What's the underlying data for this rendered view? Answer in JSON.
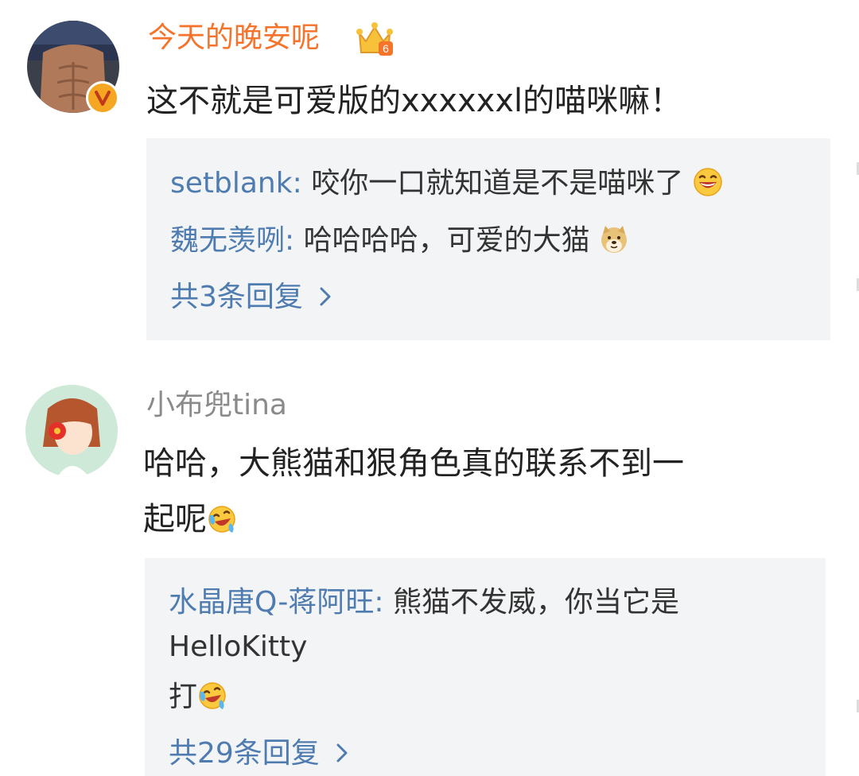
{
  "comments": [
    {
      "username": "今天的晚安呢",
      "vip_badge_number": "6",
      "text": "这不就是可爱版的xxxxxxl的喵咪嘛！",
      "replies": [
        {
          "name": "setblank",
          "text": "咬你一口就知道是不是喵咪了",
          "emoji": "laughing-emoji-icon"
        },
        {
          "name": "魏无羡咧",
          "text": "哈哈哈哈，可爱的大猫",
          "emoji": "doge-emoji-icon"
        }
      ],
      "more_replies_label": "共3条回复"
    },
    {
      "username": "小布兜tina",
      "text_line1": "哈哈，大熊猫和狠角色真的联系不到一",
      "text_line2": "起呢",
      "text_emoji": "crying-laughing-emoji-icon",
      "replies": [
        {
          "name": "水晶唐Q-蒋阿旺",
          "text": "熊猫不发威，你当它是",
          "text_line2": "HelloKitty",
          "text_line3": "打",
          "emoji": "crying-laughing-emoji-icon"
        }
      ],
      "more_replies_label": "共29条回复"
    }
  ],
  "reply_separator": ":",
  "colors": {
    "vip_name": "#f5732a",
    "normal_name": "#8a8a8a",
    "link_blue": "#4f7cb0",
    "reply_bg": "#f3f4f6",
    "verified_badge": "#f5a623"
  }
}
